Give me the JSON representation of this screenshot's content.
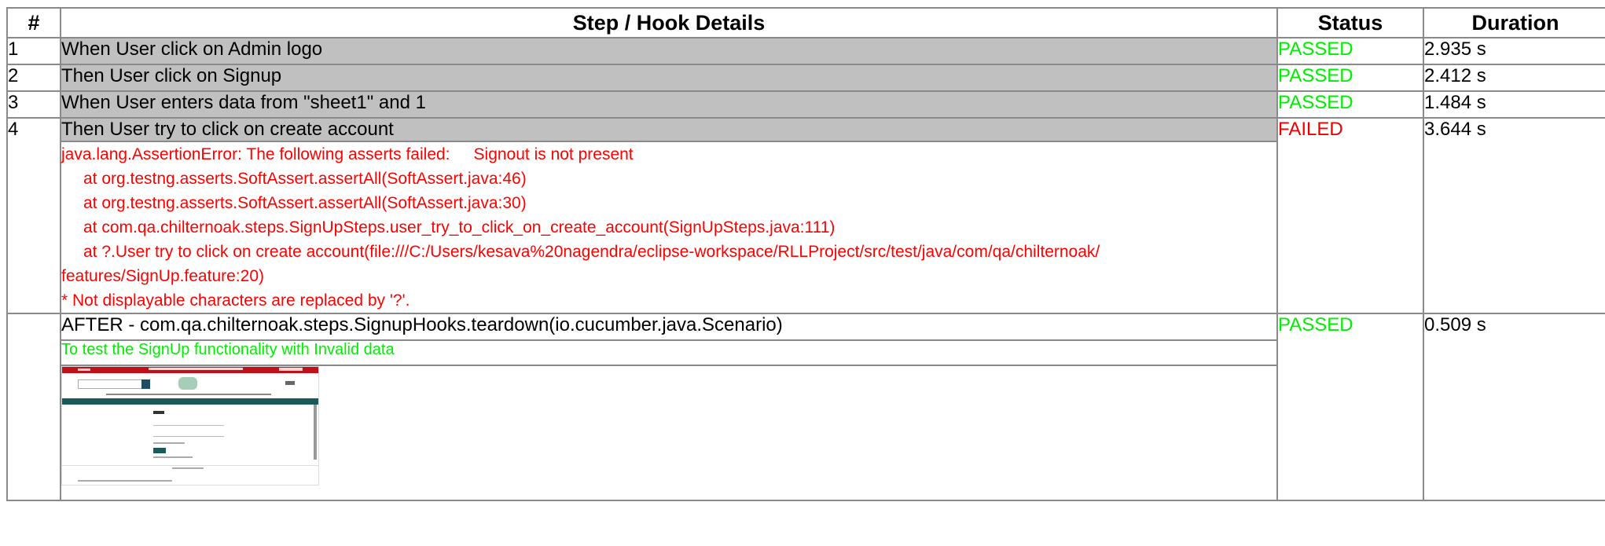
{
  "headers": {
    "num": "#",
    "details": "Step / Hook Details",
    "status": "Status",
    "duration": "Duration"
  },
  "steps": [
    {
      "num": "1",
      "text": "When User click on Admin logo",
      "status": "PASSED",
      "duration": "2.935 s"
    },
    {
      "num": "2",
      "text": "Then User click on Signup",
      "status": "PASSED",
      "duration": "2.412 s"
    },
    {
      "num": "3",
      "text": "When User enters data from \"sheet1\" and 1",
      "status": "PASSED",
      "duration": "1.484 s"
    },
    {
      "num": "4",
      "text": "Then User try to click on create account",
      "status": "FAILED",
      "duration": "3.644 s"
    }
  ],
  "error": {
    "first_line": "java.lang.AssertionError: The following asserts failed:",
    "first_line_cont": "Signout is not present",
    "stack": [
      "at org.testng.asserts.SoftAssert.assertAll(SoftAssert.java:46)",
      "at org.testng.asserts.SoftAssert.assertAll(SoftAssert.java:30)",
      "at com.qa.chilternoak.steps.SignUpSteps.user_try_to_click_on_create_account(SignUpSteps.java:111)",
      "at ?.User try to click on create account(file:///C:/Users/kesava%20nagendra/eclipse-workspace/RLLProject/src/test/java/com/qa/chilternoak/"
    ],
    "stack_wrap": "features/SignUp.feature:20)",
    "note": "* Not displayable characters are replaced by '?'."
  },
  "hook": {
    "text": "AFTER - com.qa.chilternoak.steps.SignupHooks.teardown(io.cucumber.java.Scenario)",
    "status": "PASSED",
    "duration": "0.509 s",
    "description": "To test the SignUp functionality with Invalid data"
  },
  "colors": {
    "passed": "#00ee00",
    "failed": "#ee0000",
    "step_bg": "#c0c0c0",
    "border": "#8a8a8a"
  }
}
